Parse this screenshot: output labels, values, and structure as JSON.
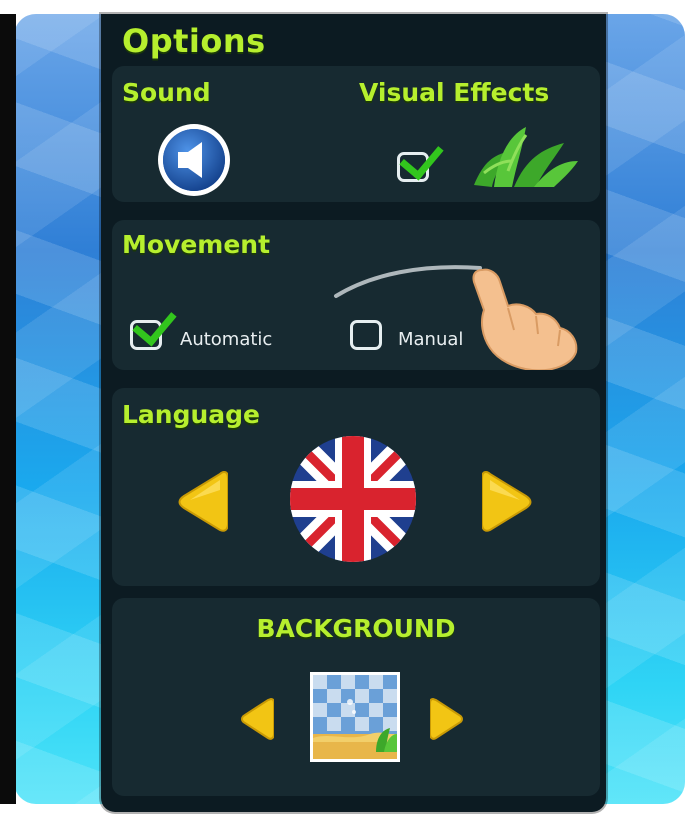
{
  "title": "Options",
  "sound": {
    "label": "Sound",
    "icon": "speaker-icon"
  },
  "visual_effects": {
    "label": "Visual Effects",
    "checked": true,
    "icon": "seaweed-icon"
  },
  "movement": {
    "label": "Movement",
    "options": [
      {
        "label": "Automatic",
        "checked": true
      },
      {
        "label": "Manual",
        "checked": false
      }
    ],
    "icon": "swipe-hand-icon"
  },
  "language": {
    "label": "Language",
    "selected_flag": "uk-flag-icon"
  },
  "background": {
    "label": "BACKGROUND",
    "thumbnail": "background-thumbnail"
  },
  "colors": {
    "accent_green": "#b6ef2e",
    "check_green": "#32c61d",
    "arrow_yellow": "#f2c514"
  }
}
